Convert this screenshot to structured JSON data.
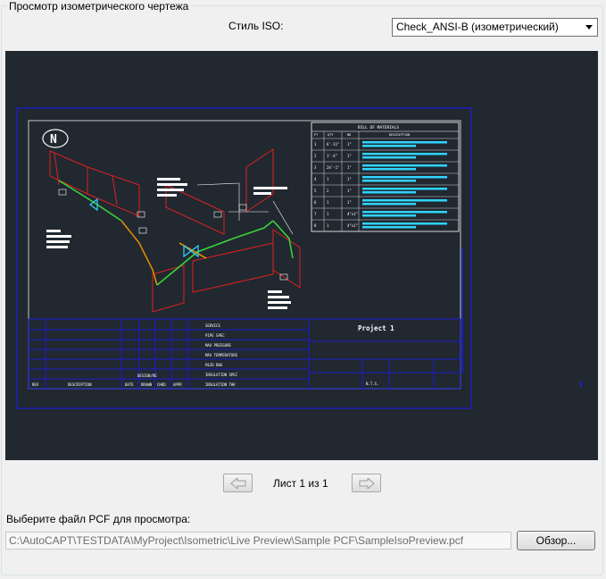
{
  "group": {
    "title": "Просмотр изометрического чертежа"
  },
  "style": {
    "label": "Стиль ISO:",
    "selected": "Check_ANSI-B (изометрический)"
  },
  "drawing": {
    "north_mark": "N",
    "bom_title": "BILL OF MATERIALS",
    "bom_headers": [
      "PT",
      "QTY",
      "ND",
      "DESCRIPTION"
    ],
    "bom_rows": [
      {
        "pt": "1",
        "qty": "6'-11\"",
        "nd": "1\""
      },
      {
        "pt": "2",
        "qty": "1'-4\"",
        "nd": "1\""
      },
      {
        "pt": "3",
        "qty": "24'-1\"",
        "nd": "1\""
      },
      {
        "pt": "4",
        "qty": "1",
        "nd": "1\""
      },
      {
        "pt": "5",
        "qty": "2",
        "nd": "1\""
      },
      {
        "pt": "6",
        "qty": "1",
        "nd": "1\""
      },
      {
        "pt": "7",
        "qty": "1",
        "nd": "4\"x1\""
      },
      {
        "pt": "8",
        "qty": "1",
        "nd": "4\"x1\""
      }
    ],
    "title_project": "Project 1",
    "field_labels": [
      "SERVICE",
      "PIPE SPEC",
      "MAX PRESSURE",
      "MAX TEMPERATURE",
      "P&ID DWG",
      "INSULATION SPEC",
      "INSULATION THK"
    ],
    "rev_labels": [
      "REV",
      "DESCRIPTION",
      "DATE",
      "DRAWN",
      "CHKD",
      "APPR"
    ],
    "designed_label": "DESIGN/RE",
    "scale_value": "N.T.S."
  },
  "pager": {
    "text": "Лист 1 из 1",
    "prev_icon": "arrow-left-icon",
    "next_icon": "arrow-right-icon"
  },
  "pcf": {
    "label": "Выберите файл PCF для просмотра:",
    "path": "C:\\AutoCAPT\\TESTDATA\\MyProject\\Isometric\\Live Preview\\Sample PCF\\SampleIsoPreview.pcf",
    "browse": "Обзор..."
  }
}
